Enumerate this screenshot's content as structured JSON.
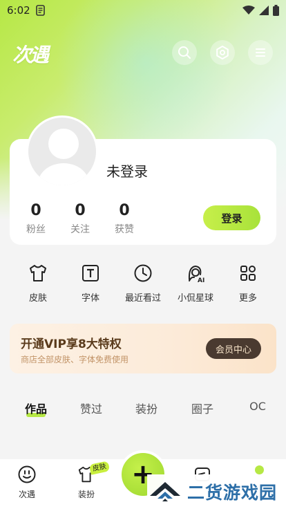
{
  "status_bar": {
    "time": "6:02"
  },
  "header": {
    "logo": "次遇"
  },
  "profile": {
    "username": "未登录",
    "stats": [
      {
        "value": "0",
        "label": "粉丝"
      },
      {
        "value": "0",
        "label": "关注"
      },
      {
        "value": "0",
        "label": "获赞"
      }
    ],
    "login_label": "登录"
  },
  "quick_actions": [
    {
      "label": "皮肤",
      "icon": "tshirt-icon"
    },
    {
      "label": "字体",
      "icon": "font-icon"
    },
    {
      "label": "最近看过",
      "icon": "clock-icon"
    },
    {
      "label": "小侃星球",
      "icon": "ai-avatar-icon"
    },
    {
      "label": "更多",
      "icon": "grid-icon"
    }
  ],
  "vip": {
    "title": "开通VIP享8大特权",
    "subtitle": "商店全部皮肤、字体免费使用",
    "button": "会员中心"
  },
  "tabs": [
    "作品",
    "赞过",
    "装扮",
    "圈子",
    "OC"
  ],
  "bottom_nav": [
    {
      "label": "次遇",
      "icon": "smile-icon"
    },
    {
      "label": "装扮",
      "icon": "tshirt-icon",
      "badge": "皮肤"
    },
    {
      "label": "",
      "icon": "plus-icon"
    },
    {
      "label": "",
      "icon": "message-icon"
    },
    {
      "label": "",
      "icon": "profile-dot-icon"
    }
  ],
  "watermark": {
    "text": "二货游戏园"
  },
  "colors": {
    "accent": "#b6e845",
    "vip_button": "#4a3a30",
    "watermark": "#2d6fa8"
  }
}
